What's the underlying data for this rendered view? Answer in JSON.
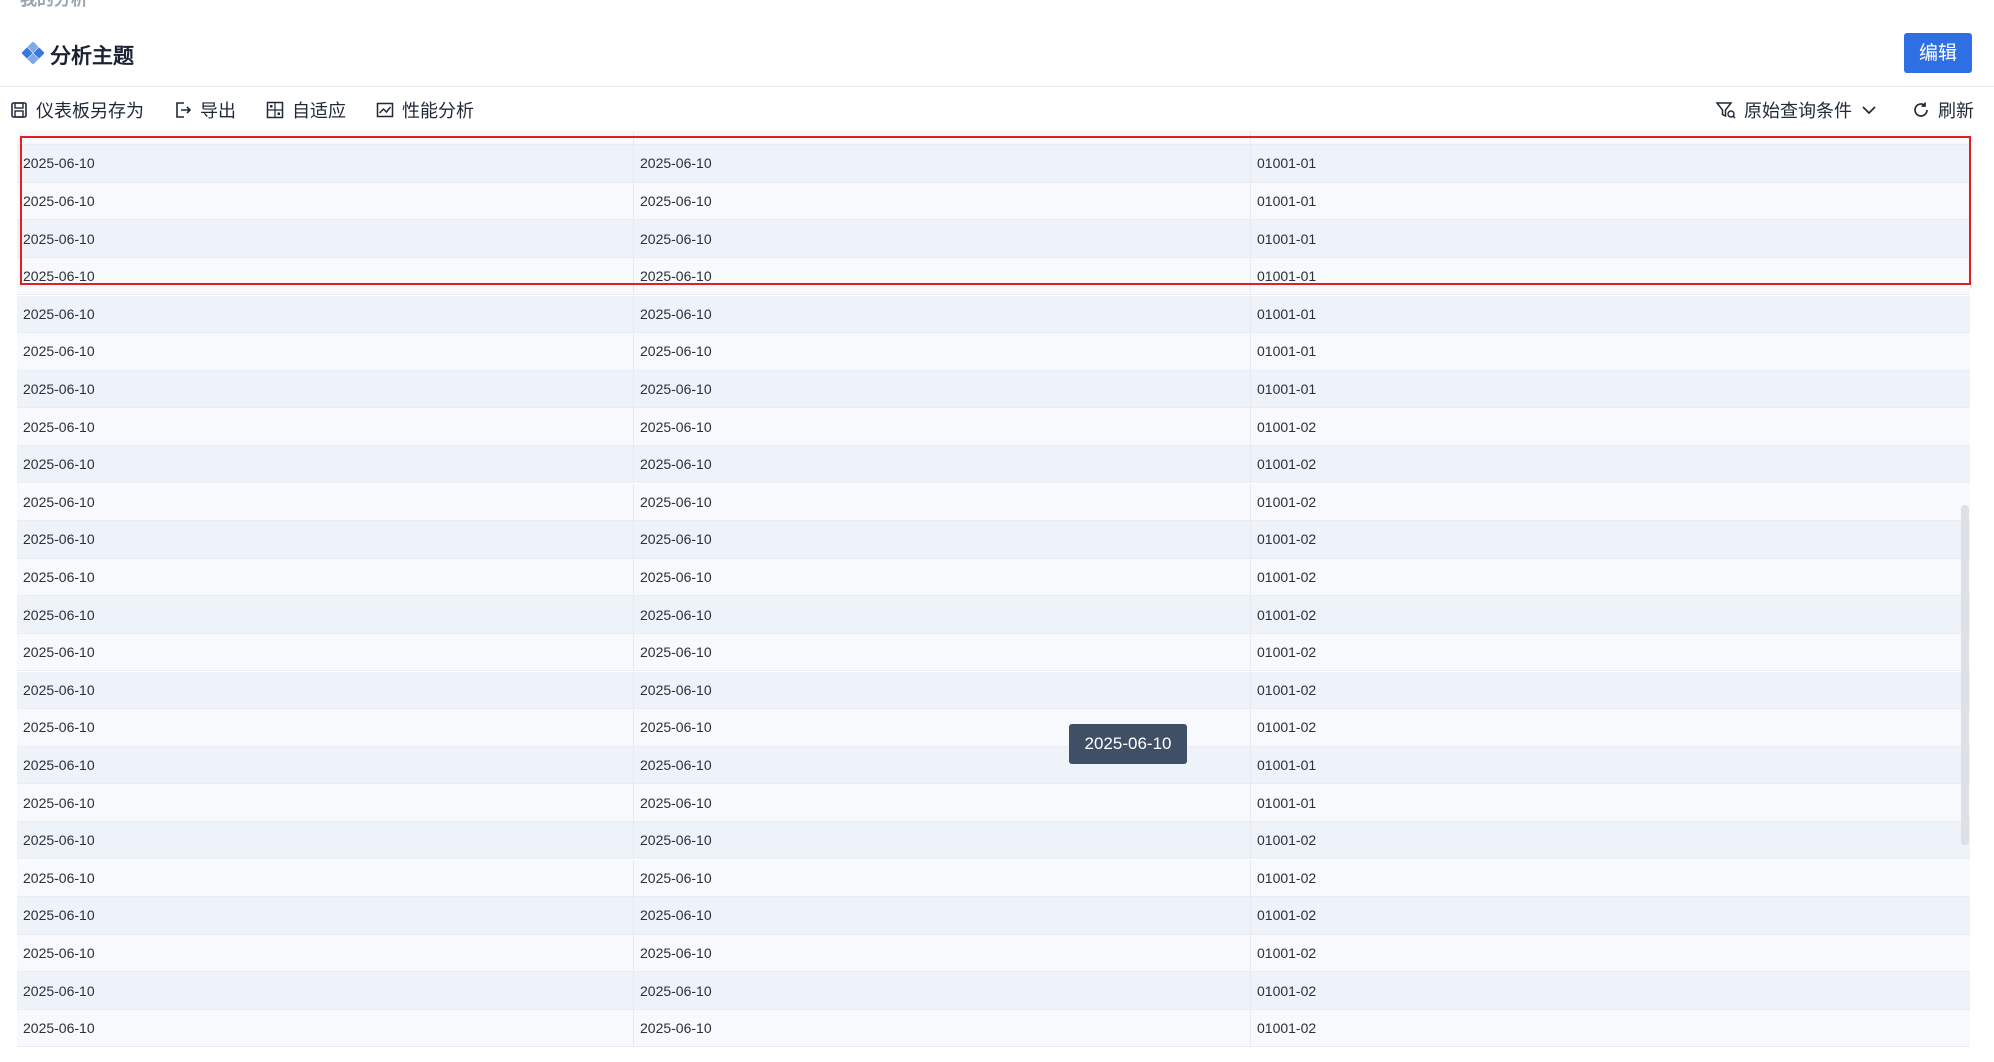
{
  "breadcrumb": "我的分析",
  "header": {
    "title": "分析主题",
    "edit_label": "编辑"
  },
  "toolbar": {
    "save_as": "仪表板另存为",
    "export": "导出",
    "adaptive": "自适应",
    "performance": "性能分析",
    "query_conditions": "原始查询条件",
    "refresh": "刷新"
  },
  "table": {
    "partial_top_row": [
      "2025-06-10",
      "2025-06-10",
      "01001-02"
    ],
    "rows": [
      [
        "2025-06-10",
        "2025-06-10",
        "01001-01"
      ],
      [
        "2025-06-10",
        "2025-06-10",
        "01001-01"
      ],
      [
        "2025-06-10",
        "2025-06-10",
        "01001-01"
      ],
      [
        "2025-06-10",
        "2025-06-10",
        "01001-01"
      ],
      [
        "2025-06-10",
        "2025-06-10",
        "01001-01"
      ],
      [
        "2025-06-10",
        "2025-06-10",
        "01001-01"
      ],
      [
        "2025-06-10",
        "2025-06-10",
        "01001-01"
      ],
      [
        "2025-06-10",
        "2025-06-10",
        "01001-02"
      ],
      [
        "2025-06-10",
        "2025-06-10",
        "01001-02"
      ],
      [
        "2025-06-10",
        "2025-06-10",
        "01001-02"
      ],
      [
        "2025-06-10",
        "2025-06-10",
        "01001-02"
      ],
      [
        "2025-06-10",
        "2025-06-10",
        "01001-02"
      ],
      [
        "2025-06-10",
        "2025-06-10",
        "01001-02"
      ],
      [
        "2025-06-10",
        "2025-06-10",
        "01001-02"
      ],
      [
        "2025-06-10",
        "2025-06-10",
        "01001-02"
      ],
      [
        "2025-06-10",
        "2025-06-10",
        "01001-02"
      ],
      [
        "2025-06-10",
        "2025-06-10",
        "01001-01"
      ],
      [
        "2025-06-10",
        "2025-06-10",
        "01001-01"
      ],
      [
        "2025-06-10",
        "2025-06-10",
        "01001-02"
      ],
      [
        "2025-06-10",
        "2025-06-10",
        "01001-02"
      ],
      [
        "2025-06-10",
        "2025-06-10",
        "01001-02"
      ],
      [
        "2025-06-10",
        "2025-06-10",
        "01001-02"
      ],
      [
        "2025-06-10",
        "2025-06-10",
        "01001-02"
      ],
      [
        "2025-06-10",
        "2025-06-10",
        "01001-02"
      ]
    ]
  },
  "tooltip": "2025-06-10",
  "colors": {
    "accent": "#2f6fe4",
    "highlight_border": "#e02020",
    "tooltip_bg": "#3f4f66"
  },
  "icons": {
    "title": "diamond-icon",
    "save_as": "save-icon",
    "export": "export-icon",
    "adaptive": "grid-icon",
    "performance": "chart-icon",
    "query_conditions": "filter-icon",
    "refresh": "refresh-icon"
  }
}
